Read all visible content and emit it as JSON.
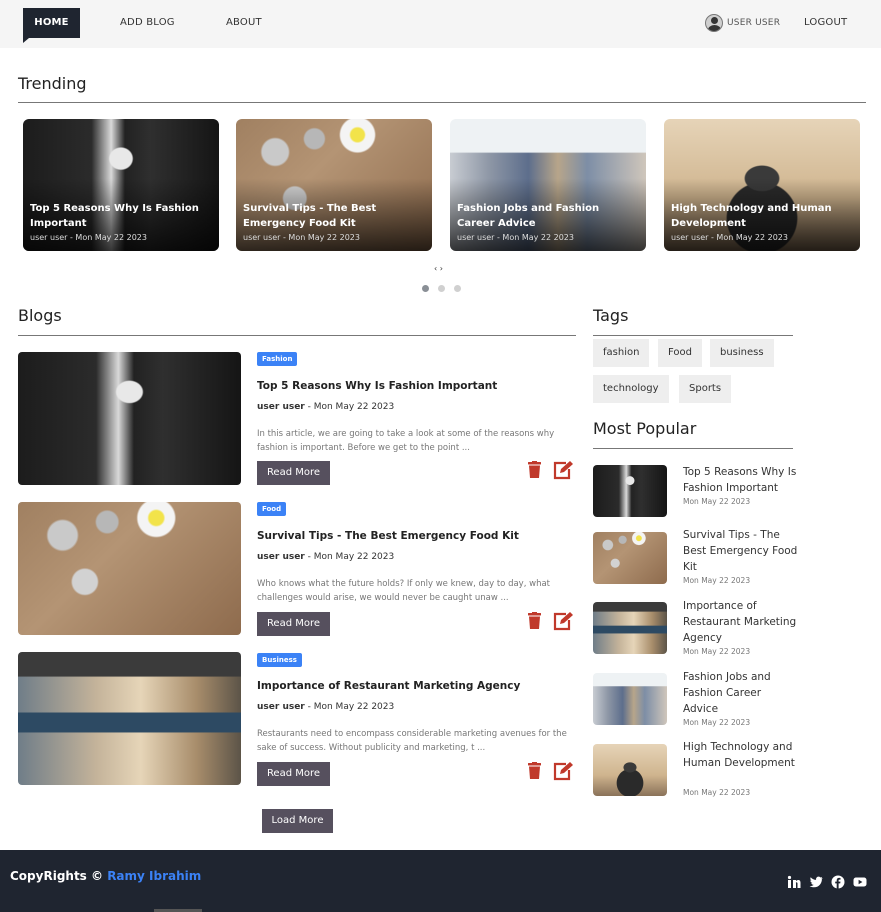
{
  "nav": {
    "home": "HOME",
    "add_blog": "ADD BLOG",
    "about": "ABOUT",
    "user": "USER USER",
    "logout": "LOGOUT"
  },
  "trending": {
    "heading": "Trending",
    "cards": [
      {
        "title": "Top 5 Reasons Why Is Fashion Important",
        "meta": "user user - Mon May 22 2023"
      },
      {
        "title": "Survival Tips - The Best Emergency Food Kit",
        "meta": "user user - Mon May 22 2023"
      },
      {
        "title": "Fashion Jobs and Fashion Career Advice",
        "meta": "user user - Mon May 22 2023"
      },
      {
        "title": "High Technology and Human Development",
        "meta": "user user - Mon May 22 2023"
      }
    ],
    "arrows": "‹ ›"
  },
  "blogs": {
    "heading": "Blogs",
    "items": [
      {
        "category": "Fashion",
        "title": "Top 5 Reasons Why Is Fashion Important",
        "author": "user user",
        "date": " - Mon May 22 2023",
        "excerpt": "In this article, we are going to take a look at some of the reasons why fashion is important. Before we get to the point ...",
        "read_more": "Read More"
      },
      {
        "category": "Food",
        "title": "Survival Tips - The Best Emergency Food Kit",
        "author": "user user",
        "date": " - Mon May 22 2023",
        "excerpt": "Who knows what the future holds? If only we knew, day to day, what challenges would arise, we would never be caught unaw ...",
        "read_more": "Read More"
      },
      {
        "category": "Business",
        "title": "Importance of Restaurant Marketing Agency",
        "author": "user user",
        "date": " - Mon May 22 2023",
        "excerpt": "Restaurants need to encompass considerable marketing avenues for the sake of success. Without publicity and marketing, t ...",
        "read_more": "Read More"
      }
    ],
    "load_more": "Load More"
  },
  "tags": {
    "heading": "Tags",
    "items": [
      "fashion",
      "Food",
      "business",
      "technology",
      "Sports"
    ]
  },
  "popular": {
    "heading": "Most Popular",
    "items": [
      {
        "title": "Top 5 Reasons Why Is Fashion Important",
        "date": "Mon May 22 2023"
      },
      {
        "title": "Survival Tips - The Best Emergency Food Kit",
        "date": "Mon May 22 2023"
      },
      {
        "title": "Importance of Restaurant Marketing Agency",
        "date": "Mon May 22 2023"
      },
      {
        "title": "Fashion Jobs and Fashion Career Advice",
        "date": "Mon May 22 2023"
      },
      {
        "title": "High Technology and Human Development",
        "date": "Mon May 22 2023"
      }
    ]
  },
  "footer": {
    "copyright": "CopyRights © ",
    "owner": "Ramy Ibrahim",
    "social": [
      "linkedin-icon",
      "twitter-icon",
      "facebook-icon",
      "youtube-icon"
    ]
  },
  "colors": {
    "nav_active": "#1f2530",
    "badge": "#3b82f6",
    "button": "#56505e",
    "action_icons": "#c0392b",
    "footer": "#1f2530"
  }
}
